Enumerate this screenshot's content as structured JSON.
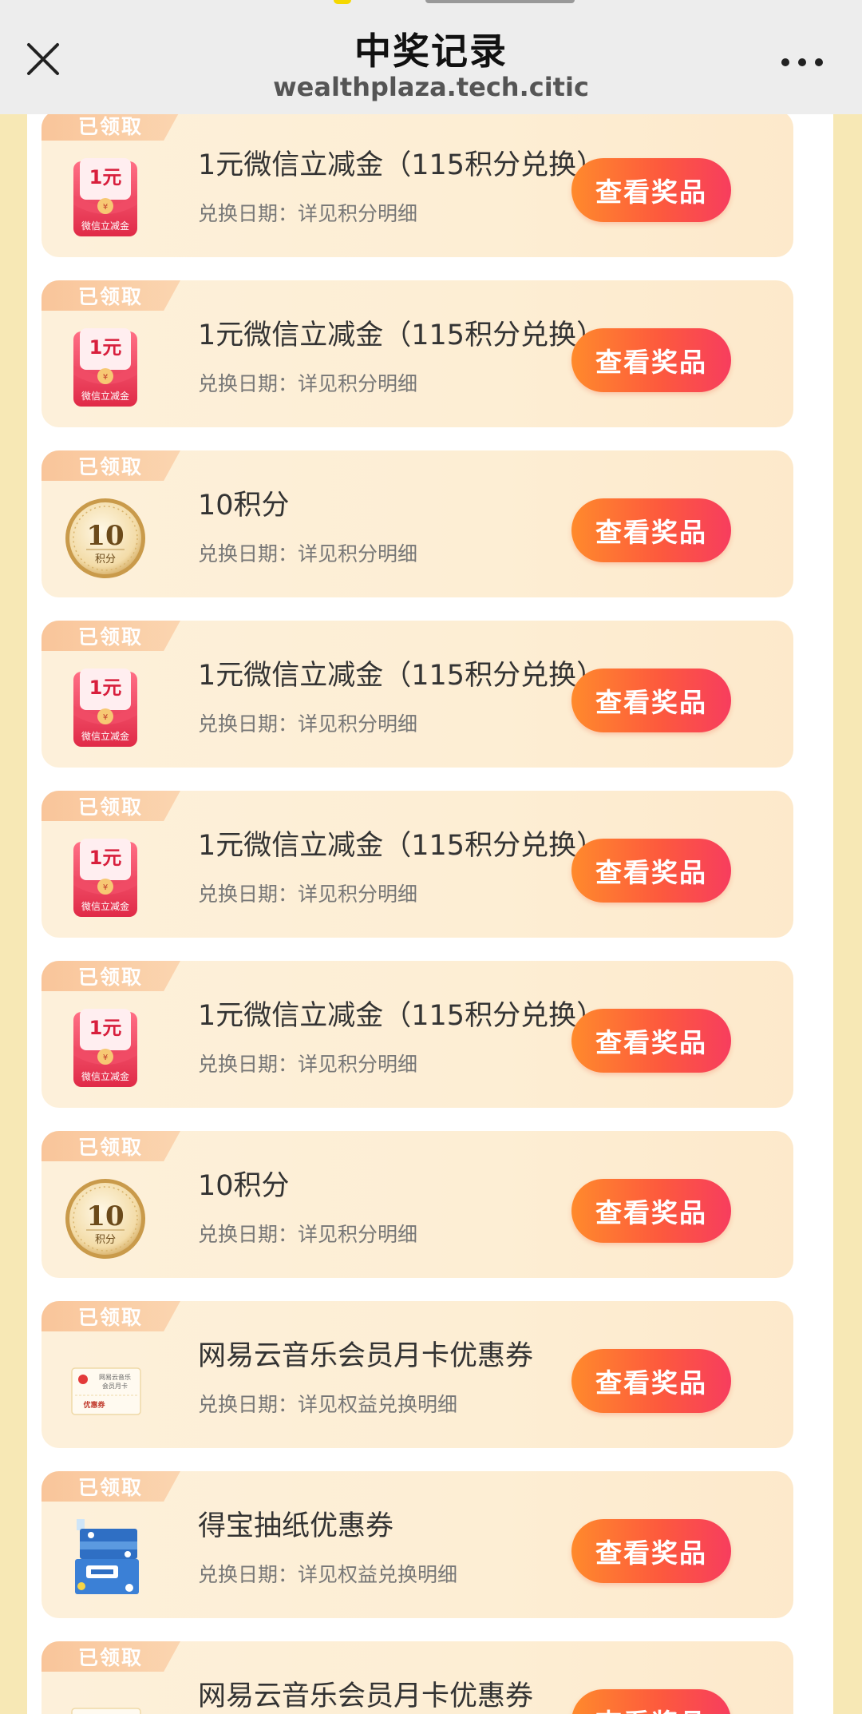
{
  "header": {
    "title": "中奖记录",
    "url": "wealthplaza.tech.citic"
  },
  "records": [
    {
      "status": "已领取",
      "name": "1元微信立减金（115积分兑换）",
      "date": "兑换日期：详见积分明细",
      "button": "查看奖品",
      "image": "red-envelope-icon"
    },
    {
      "status": "已领取",
      "name": "1元微信立减金（115积分兑换）",
      "date": "兑换日期：详见积分明细",
      "button": "查看奖品",
      "image": "red-envelope-icon"
    },
    {
      "status": "已领取",
      "name": "10积分",
      "date": "兑换日期：详见积分明细",
      "button": "查看奖品",
      "image": "points-coin-icon"
    },
    {
      "status": "已领取",
      "name": "1元微信立减金（115积分兑换）",
      "date": "兑换日期：详见积分明细",
      "button": "查看奖品",
      "image": "red-envelope-icon"
    },
    {
      "status": "已领取",
      "name": "1元微信立减金（115积分兑换）",
      "date": "兑换日期：详见积分明细",
      "button": "查看奖品",
      "image": "red-envelope-icon"
    },
    {
      "status": "已领取",
      "name": "1元微信立减金（115积分兑换）",
      "date": "兑换日期：详见积分明细",
      "button": "查看奖品",
      "image": "red-envelope-icon"
    },
    {
      "status": "已领取",
      "name": "10积分",
      "date": "兑换日期：详见积分明细",
      "button": "查看奖品",
      "image": "points-coin-icon"
    },
    {
      "status": "已领取",
      "name": "网易云音乐会员月卡优惠券",
      "date": "兑换日期：详见权益兑换明细",
      "button": "查看奖品",
      "image": "music-coupon-icon"
    },
    {
      "status": "已领取",
      "name": "得宝抽纸优惠券",
      "date": "兑换日期：详见权益兑换明细",
      "button": "查看奖品",
      "image": "tissue-pack-icon"
    },
    {
      "status": "已领取",
      "name": "网易云音乐会员月卡优惠券",
      "date": "",
      "button": "查看奖品",
      "image": "music-coupon-icon"
    }
  ],
  "image_text": {
    "envelope_amount": "1元",
    "envelope_caption": "微信立减金",
    "coin_number": "10",
    "coin_caption": "积分",
    "coupon_header": "网易云音乐",
    "coupon_sub": "会员月卡",
    "coupon_tag": "优惠券"
  },
  "colors": {
    "background": "#f7e8b5",
    "button_start": "#ff8a2c",
    "button_end": "#f73d5e",
    "badge": "#f9c59a"
  }
}
